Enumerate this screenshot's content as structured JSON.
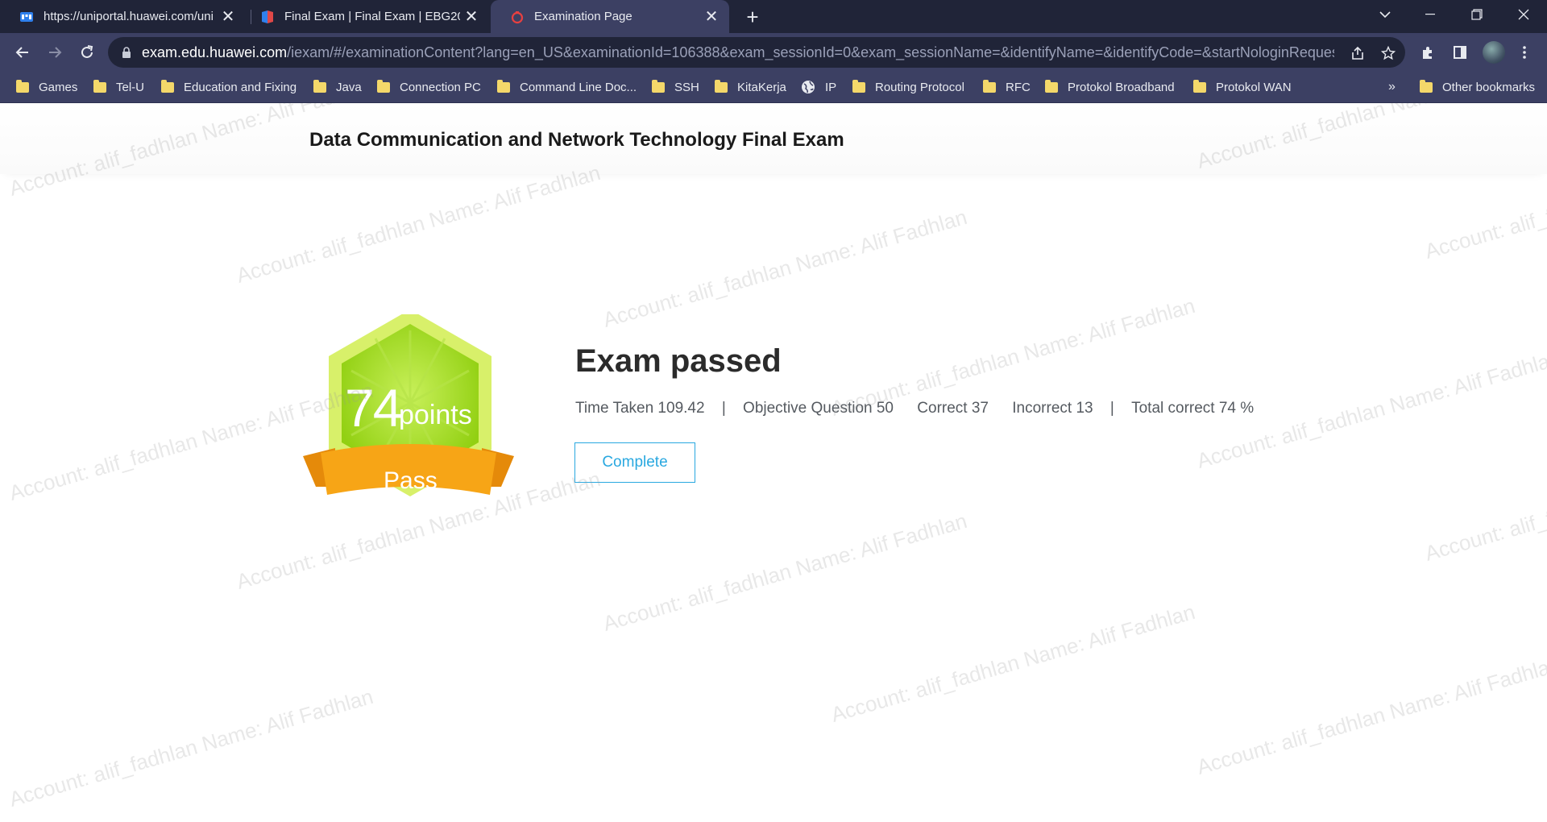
{
  "browser": {
    "tabs": [
      {
        "title": "https://uniportal.huawei.com/uni",
        "active": false
      },
      {
        "title": "Final Exam | Final Exam | EBG202",
        "active": false
      },
      {
        "title": "Examination Page",
        "active": true
      }
    ],
    "new_tab_symbol": "+",
    "url_host": "exam.edu.huawei.com",
    "url_rest": "/iexam/#/examinationContent?lang=en_US&examinationId=106388&exam_sessionId=0&exam_sessionName=&identifyName=&identifyCode=&startNologinRequest=...",
    "bookmarks": [
      {
        "label": "Games",
        "icon": "folder-icon"
      },
      {
        "label": "Tel-U",
        "icon": "folder-icon"
      },
      {
        "label": "Education and Fixing",
        "icon": "folder-icon"
      },
      {
        "label": "Java",
        "icon": "folder-icon"
      },
      {
        "label": "Connection PC",
        "icon": "folder-icon"
      },
      {
        "label": "Command Line Doc...",
        "icon": "folder-icon"
      },
      {
        "label": "SSH",
        "icon": "folder-icon"
      },
      {
        "label": "KitaKerja",
        "icon": "folder-icon"
      },
      {
        "label": "IP",
        "icon": "globe-icon"
      },
      {
        "label": "Routing Protocol",
        "icon": "folder-icon"
      },
      {
        "label": "RFC",
        "icon": "folder-icon"
      },
      {
        "label": "Protokol Broadband",
        "icon": "folder-icon"
      },
      {
        "label": "Protokol WAN",
        "icon": "folder-icon"
      }
    ],
    "overflow_symbol": "»",
    "other_bookmarks": "Other bookmarks"
  },
  "page": {
    "exam_title": "Data Communication and Network Technology Final Exam",
    "badge": {
      "score": "74",
      "unit": "points",
      "status": "Pass"
    },
    "result_title": "Exam passed",
    "stats": {
      "time_taken": "Time Taken 109.42",
      "objective": "Objective Question 50",
      "correct": "Correct 37",
      "incorrect": "Incorrect 13",
      "total_correct": "Total correct 74 %",
      "separator": "|"
    },
    "complete_label": "Complete",
    "watermark_text": "Account: alif_fadhlan Name: Alif Fadhlan"
  },
  "colors": {
    "tabbar": "#202438",
    "toolbar": "#3c4063",
    "accent": "#29a8e0",
    "badge_green": "#a6dc1e",
    "badge_orange": "#f5a20f"
  }
}
